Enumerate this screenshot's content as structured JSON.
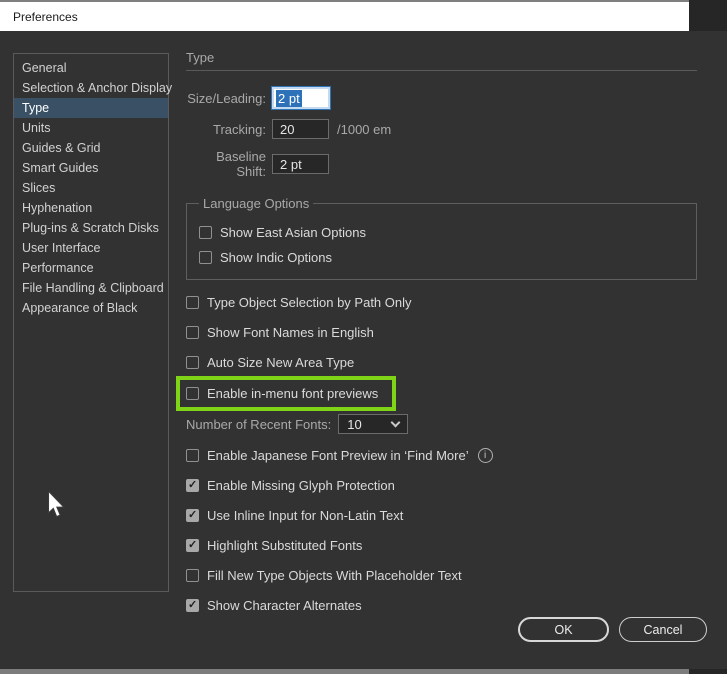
{
  "window": {
    "title": "Preferences"
  },
  "sidebar": {
    "items": [
      {
        "label": "General",
        "selected": false
      },
      {
        "label": "Selection & Anchor Display",
        "selected": false
      },
      {
        "label": "Type",
        "selected": true
      },
      {
        "label": "Units",
        "selected": false
      },
      {
        "label": "Guides & Grid",
        "selected": false
      },
      {
        "label": "Smart Guides",
        "selected": false
      },
      {
        "label": "Slices",
        "selected": false
      },
      {
        "label": "Hyphenation",
        "selected": false
      },
      {
        "label": "Plug-ins & Scratch Disks",
        "selected": false
      },
      {
        "label": "User Interface",
        "selected": false
      },
      {
        "label": "Performance",
        "selected": false
      },
      {
        "label": "File Handling & Clipboard",
        "selected": false
      },
      {
        "label": "Appearance of Black",
        "selected": false
      }
    ]
  },
  "panel": {
    "section_title": "Type",
    "size_leading": {
      "label": "Size/Leading:",
      "value": "2 pt"
    },
    "tracking": {
      "label": "Tracking:",
      "value": "20",
      "suffix": "/1000 em"
    },
    "baseline_shift": {
      "label": "Baseline Shift:",
      "value": "2 pt"
    },
    "language_options": {
      "legend": "Language Options",
      "items": [
        {
          "label": "Show East Asian Options",
          "checked": false
        },
        {
          "label": "Show Indic Options",
          "checked": false
        }
      ]
    },
    "checkboxes_top": [
      {
        "label": "Type Object Selection by Path Only",
        "checked": false
      },
      {
        "label": "Show Font Names in English",
        "checked": false
      },
      {
        "label": "Auto Size New Area Type",
        "checked": false
      }
    ],
    "highlighted_checkbox": {
      "label": "Enable in-menu font previews",
      "checked": false
    },
    "recent_fonts": {
      "label": "Number of Recent Fonts:",
      "value": "10"
    },
    "japanese_preview": {
      "label": "Enable Japanese Font Preview in ‘Find More’",
      "checked": false
    },
    "checkboxes_bottom": [
      {
        "label": "Enable Missing Glyph Protection",
        "checked": true
      },
      {
        "label": "Use Inline Input for Non-Latin Text",
        "checked": true
      },
      {
        "label": "Highlight Substituted Fonts",
        "checked": true
      },
      {
        "label": "Fill New Type Objects With Placeholder Text",
        "checked": false
      },
      {
        "label": "Show Character Alternates",
        "checked": true
      }
    ]
  },
  "footer": {
    "ok_label": "OK",
    "cancel_label": "Cancel"
  },
  "icons": {
    "info_glyph": "i"
  },
  "colors": {
    "highlight_green": "#7fd417",
    "selection_blue": "#2d71b8",
    "sidebar_selected_bg": "#3a5165",
    "dialog_bg": "#323232",
    "titlebar_bg": "#ffffff"
  }
}
